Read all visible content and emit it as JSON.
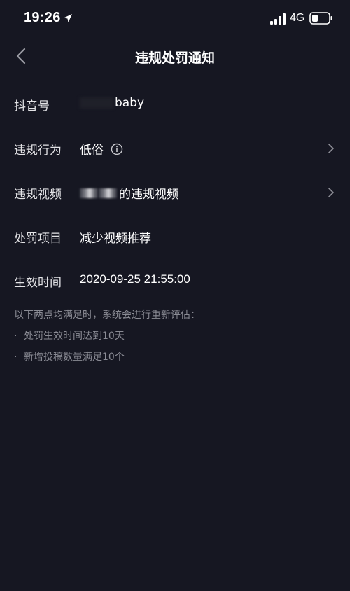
{
  "status_bar": {
    "time": "19:26",
    "network": "4G",
    "icons": [
      "location-arrow-icon",
      "signal-bars-icon",
      "battery-icon"
    ]
  },
  "nav": {
    "title": "违规处罚通知",
    "back_icon": "chevron-left-icon"
  },
  "rows": [
    {
      "label": "抖音号",
      "value": "baby"
    },
    {
      "label": "违规行为",
      "value": "低俗",
      "icon": "info-circle-icon",
      "has_chevron": true
    },
    {
      "label": "违规视频",
      "value": "的违规视频",
      "has_chevron": true
    },
    {
      "label": "处罚项目",
      "value": "减少视频推荐"
    },
    {
      "label": "生效时间",
      "value": "2020-09-25 21:55:00"
    }
  ],
  "notes": {
    "intro": "以下两点均满足时，系统会进行重新评估：",
    "items": [
      "处罚生效时间达到10天",
      "新增投稿数量满足10个"
    ],
    "bullet": "·"
  },
  "colors": {
    "background": "#161722",
    "primary_text": "#ffffff",
    "secondary_text": "#8a8b94"
  }
}
